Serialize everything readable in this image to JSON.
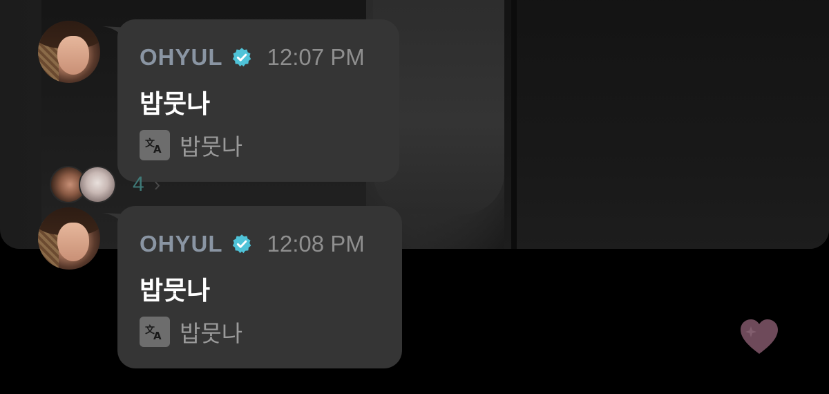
{
  "colors": {
    "bubble_bg": "#353535",
    "sender": "#8a95a3",
    "verified": "#4fc3d8",
    "time": "#8f8f8f",
    "message": "#ffffff",
    "translation": "#9a9a9a",
    "heart": "#6e4a5a"
  },
  "messages": [
    {
      "sender": "OHYUL",
      "verified_icon": "verified-badge-icon",
      "time": "12:07 PM",
      "text": "밥뭇나",
      "translation_icon": "translate-icon",
      "translation": "밥뭇나"
    },
    {
      "sender": "OHYUL",
      "verified_icon": "verified-badge-icon",
      "time": "12:08 PM",
      "text": "밥뭇나",
      "translation_icon": "translate-icon",
      "translation": "밥뭇나"
    }
  ],
  "thread": {
    "count": "4",
    "chevron": "›"
  },
  "reaction_icon": "heart-icon"
}
